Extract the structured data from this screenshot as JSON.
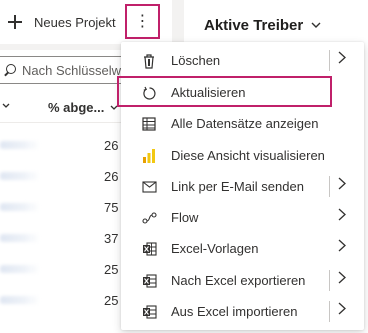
{
  "commandbar": {
    "new_project_label": "Neues Projekt",
    "more_button_glyph": "⋮"
  },
  "view": {
    "title": "Aktive Treiber",
    "chevron": "⌄"
  },
  "search": {
    "placeholder": "Nach Schlüsselwort filtern"
  },
  "grid": {
    "column_header": "% abge...",
    "rows": [
      {
        "value": "26"
      },
      {
        "value": "26"
      },
      {
        "value": "75"
      },
      {
        "value": "37"
      },
      {
        "value": "25"
      },
      {
        "value": "25"
      }
    ]
  },
  "menu": {
    "items": [
      {
        "label": "Löschen",
        "icon": "trash-icon",
        "submenu": true
      },
      {
        "label": "Aktualisieren",
        "icon": "refresh-icon",
        "submenu": false
      },
      {
        "label": "Alle Datensätze anzeigen",
        "icon": "table-icon",
        "submenu": false
      },
      {
        "label": "Diese Ansicht visualisieren",
        "icon": "chart-icon",
        "submenu": false
      },
      {
        "label": "Link per E-Mail senden",
        "icon": "email-link-icon",
        "submenu": true
      },
      {
        "label": "Flow",
        "icon": "flow-icon",
        "submenu": true
      },
      {
        "label": "Excel-Vorlagen",
        "icon": "excel-template-icon",
        "submenu": true
      },
      {
        "label": "Nach Excel exportieren",
        "icon": "excel-export-icon",
        "submenu": true
      },
      {
        "label": "Aus Excel importieren",
        "icon": "excel-import-icon",
        "submenu": true
      }
    ]
  },
  "colors": {
    "highlight_border": "#c0206a",
    "chart_icon_yellow": "#f2c811",
    "chart_icon_orange": "#e8a000"
  }
}
